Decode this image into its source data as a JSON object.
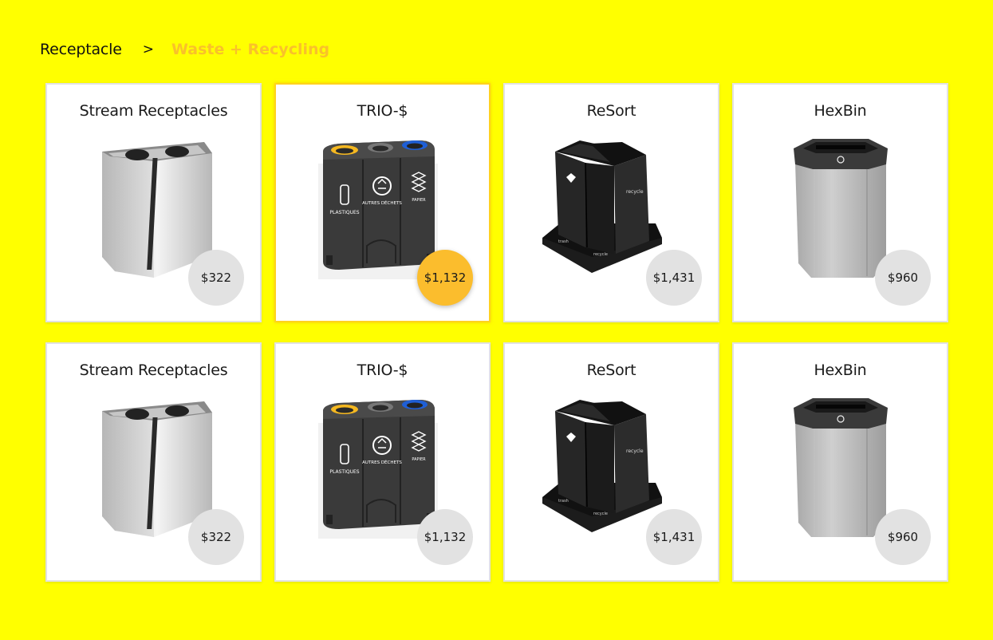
{
  "breadcrumb": {
    "root": "Receptacle",
    "separator": ">",
    "current": "Waste + Recycling"
  },
  "products": [
    {
      "name": "Stream Receptacles",
      "price": "$322",
      "image": "stream-receptacle-image",
      "selected": false
    },
    {
      "name": "TRIO-$",
      "price": "$1,132",
      "image": "trio-bin-image",
      "selected": true
    },
    {
      "name": "ReSort",
      "price": "$1,431",
      "image": "resort-bin-image",
      "selected": false
    },
    {
      "name": "HexBin",
      "price": "$960",
      "image": "hexbin-image",
      "selected": false
    },
    {
      "name": "Stream Receptacles",
      "price": "$322",
      "image": "stream-receptacle-image",
      "selected": false
    },
    {
      "name": "TRIO-$",
      "price": "$1,132",
      "image": "trio-bin-image",
      "selected": false
    },
    {
      "name": "ReSort",
      "price": "$1,431",
      "image": "resort-bin-image",
      "selected": false
    },
    {
      "name": "HexBin",
      "price": "$960",
      "image": "hexbin-image",
      "selected": false
    }
  ],
  "trio_labels": {
    "left": "PLASTIQUES",
    "middle": "AUTRES DÉCHETS",
    "right": "PAPIER"
  },
  "resort_labels": {
    "front": "recycle",
    "base_left": "trash",
    "base_right": "recycle"
  },
  "colors": {
    "background": "#ffff00",
    "accent": "#fbbd2d",
    "breadcrumb_current": "#f9c12a",
    "price_badge": "#e2e2e2"
  }
}
